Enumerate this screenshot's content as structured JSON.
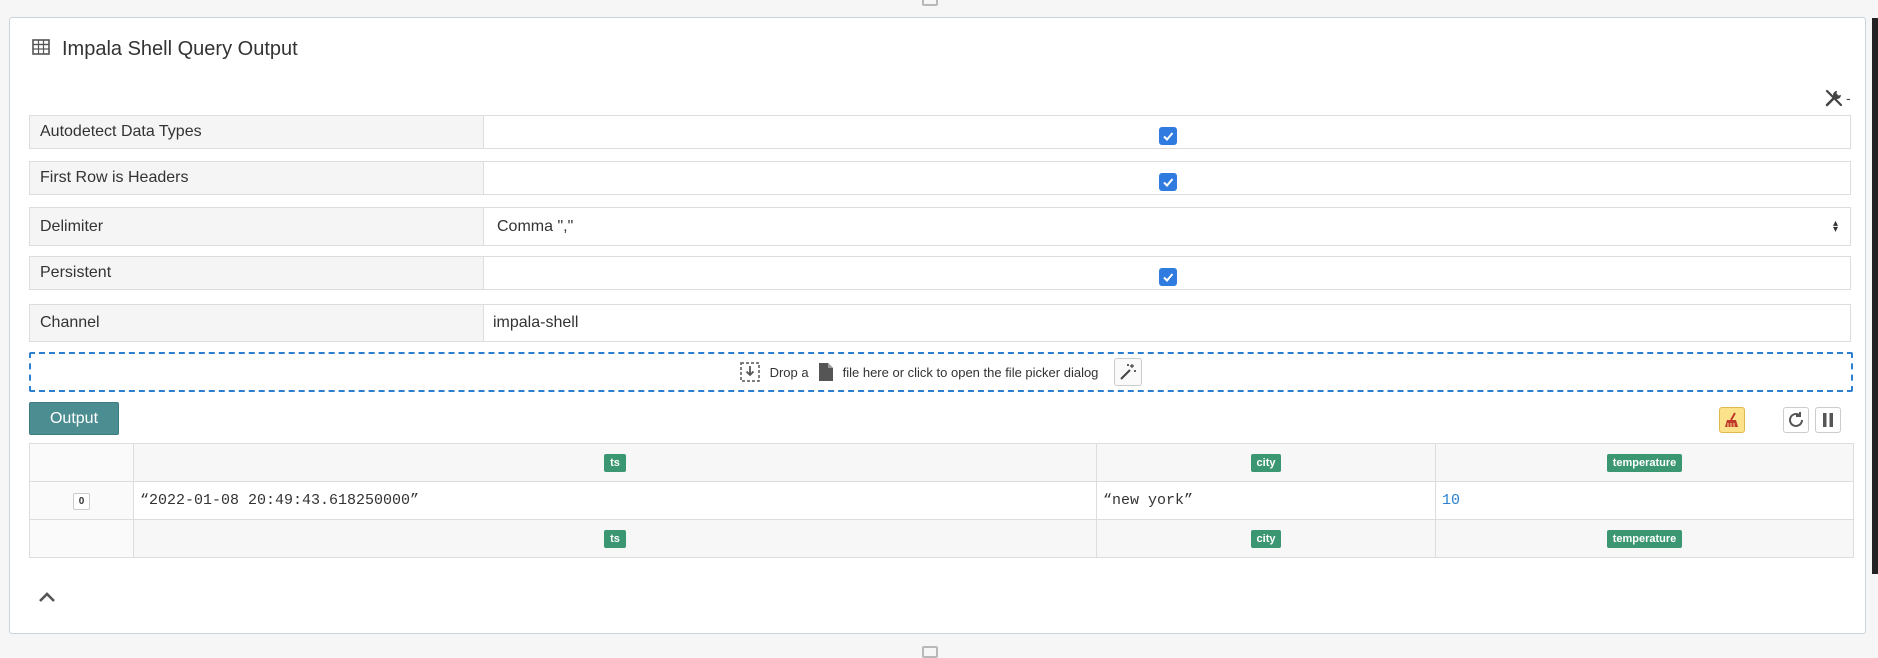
{
  "panel": {
    "title": "Impala Shell Query Output"
  },
  "form": {
    "autodetect": {
      "label": "Autodetect Data Types",
      "checked": true
    },
    "first_row_headers": {
      "label": "First Row is Headers",
      "checked": true
    },
    "delimiter": {
      "label": "Delimiter",
      "value": "Comma \",\""
    },
    "persistent": {
      "label": "Persistent",
      "checked": true
    },
    "channel": {
      "label": "Channel",
      "value": "impala-shell"
    }
  },
  "dropzone": {
    "text_before": "Drop a",
    "text_after": "file here or click to open the file picker dialog"
  },
  "output": {
    "button_label": "Output"
  },
  "table": {
    "headers": [
      "ts",
      "city",
      "temperature"
    ],
    "rows": [
      {
        "index": "0",
        "ts": "“2022-01-08 20:49:43.618250000”",
        "city": "“new york”",
        "temperature": "10"
      }
    ]
  },
  "icons": [
    "table-icon",
    "tools-icon",
    "file-drop-icon",
    "file-icon",
    "magic-wand-icon",
    "clear-output-icon",
    "refresh-icon",
    "pause-icon",
    "chevron-up-icon"
  ],
  "colors": {
    "output_button": "#4b8d91",
    "badge": "#3b9772",
    "checkbox": "#2f7be0",
    "dropzone_border": "#2b7fd0",
    "number_value": "#2b7fd0",
    "clear_button": "#fce28a"
  }
}
